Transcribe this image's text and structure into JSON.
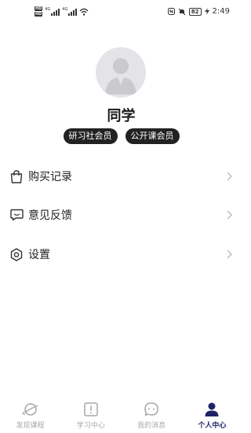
{
  "status_bar": {
    "hd_tags": [
      "HD",
      "HD"
    ],
    "network_1": "4G",
    "network_2": "4G",
    "battery": "82",
    "time": "2:49"
  },
  "profile": {
    "name": "同学",
    "badges": [
      "研习社会员",
      "公开课会员"
    ]
  },
  "menu": {
    "items": [
      {
        "label": "购买记录",
        "icon": "shopping-bag-icon"
      },
      {
        "label": "意见反馈",
        "icon": "feedback-chat-icon"
      },
      {
        "label": "设置",
        "icon": "settings-hexagon-icon"
      }
    ]
  },
  "tab_bar": {
    "tabs": [
      {
        "label": "发现课程",
        "icon": "planet-icon",
        "active": false
      },
      {
        "label": "学习中心",
        "icon": "book-exclamation-icon",
        "active": false
      },
      {
        "label": "我的消息",
        "icon": "message-bubble-icon",
        "active": false
      },
      {
        "label": "个人中心",
        "icon": "person-icon",
        "active": true
      }
    ],
    "active_color": "#1f2466",
    "inactive_color": "#a8a8a8"
  }
}
